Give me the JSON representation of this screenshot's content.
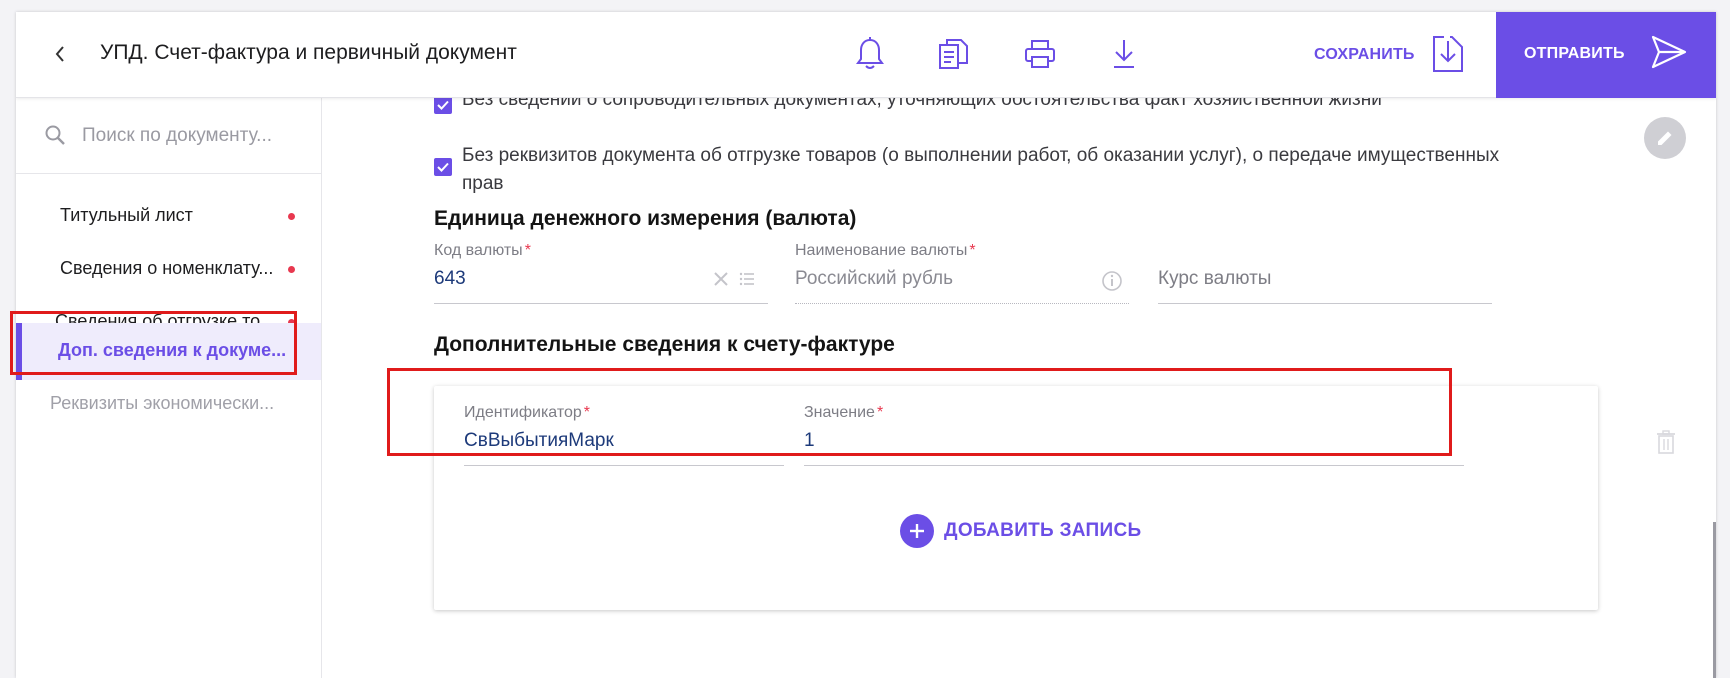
{
  "header": {
    "title": "УПД. Счет-фактура и первичный документ",
    "save_label": "СОХРАНИТЬ",
    "send_label": "ОТПРАВИТЬ",
    "icons": [
      "back-arrow-icon",
      "bell-icon",
      "documents-icon",
      "printer-icon",
      "download-icon",
      "save-icon",
      "send-icon"
    ]
  },
  "sidebar": {
    "search_placeholder": "Поиск по документу...",
    "items": [
      {
        "label": "Титульный лист",
        "has_error": true,
        "state": "normal"
      },
      {
        "label": "Сведения о номенклату...",
        "has_error": true,
        "state": "normal"
      },
      {
        "label": "Сведения об отгрузке то...",
        "has_error": true,
        "state": "normal"
      },
      {
        "label": "Доп. сведения к докуме...",
        "has_error": false,
        "state": "active"
      },
      {
        "label": "Реквизиты экономически...",
        "has_error": false,
        "state": "muted"
      }
    ]
  },
  "main": {
    "checkboxes": [
      {
        "label": "Без сведении о сопроводительных документах, уточняющих обстоятельства факт хозяйственной жизни",
        "checked": true
      },
      {
        "label": "Без реквизитов документа об отгрузке товаров (о выполнении работ, об оказании услуг), о передаче имущественных прав",
        "checked": true
      }
    ],
    "currency_section": {
      "title": "Единица денежного измерения (валюта)",
      "code_label": "Код валюты",
      "code_value": "643",
      "name_label": "Наименование валюты",
      "name_value": "Российский рубль",
      "rate_placeholder": "Курс валюты"
    },
    "additional_section": {
      "title": "Дополнительные сведения к счету-фактуре",
      "id_label": "Идентификатор",
      "id_value": "СвВыбытияМарк",
      "value_label": "Значение",
      "value_value": "1",
      "add_label": "ДОБАВИТЬ ЗАПИСЬ"
    }
  },
  "colors": {
    "accent": "#6b4ee6",
    "required": "#e8384f",
    "highlight": "#e01b1b"
  }
}
